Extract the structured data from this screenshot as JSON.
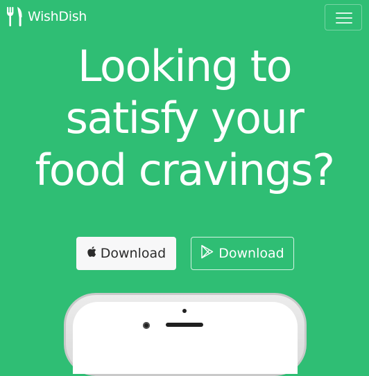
{
  "app": {
    "brand_name": "WishDish",
    "brand_icon": "fork-knife-icon",
    "menu_icon": "hamburger-menu-icon"
  },
  "hero": {
    "headline_lines": [
      "Looking to",
      "satisfy your",
      "food cravings?"
    ]
  },
  "downloads": {
    "apple_label": "Download",
    "apple_icon": "apple-icon",
    "play_label": "Download",
    "play_icon": "google-play-icon"
  },
  "colors": {
    "background": "#2fbe74",
    "text": "#ffffff",
    "apple_button_bg": "#f7f7f8"
  }
}
